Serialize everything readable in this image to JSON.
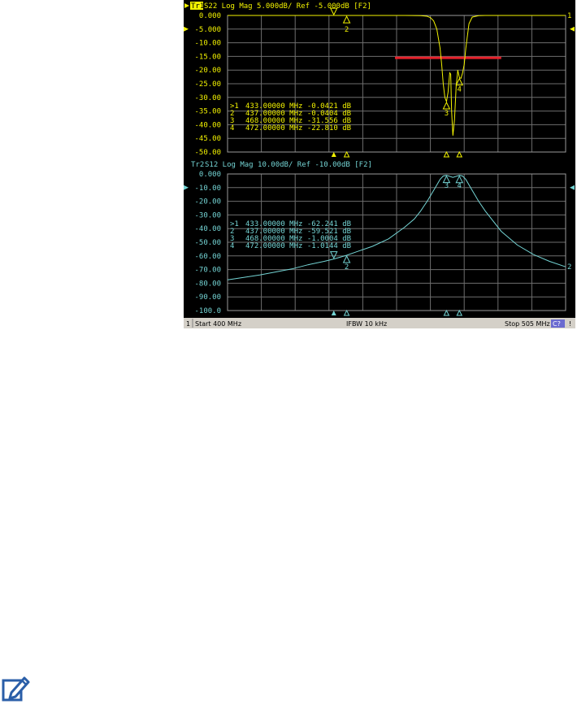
{
  "colors": {
    "background": "#000000",
    "grid": "#6e6e6e",
    "trace1": "#f2f200",
    "trace2": "#74d4d4",
    "limit_line": "#e8202a",
    "status_bar": "#d4d0c8",
    "status_text": "#000000",
    "badge_bg": "#6a6ad0"
  },
  "icons": {
    "note": "note-pencil-icon",
    "marker_down": "triangle-down",
    "marker_up": "triangle-up",
    "ref_pointer": "triangle-side"
  },
  "chart_data": [
    {
      "type": "line",
      "header": "Tr1 S22 Log Mag 5.000dB/ Ref -5.000dB [F2]",
      "trace_tag": "Tr1",
      "header_rest": " S22 Log Mag 5.000dB/ Ref -5.000dB [F2]",
      "ylim": [
        -50,
        0
      ],
      "xlim": [
        400,
        505
      ],
      "xunit": "MHz",
      "yunit": "dB",
      "grid": true,
      "ytick_labels": [
        "0.000",
        "-5.000",
        "-10.00",
        "-15.00",
        "-20.00",
        "-25.00",
        "-30.00",
        "-35.00",
        "-40.00",
        "-45.00",
        "-50.00"
      ],
      "ref_level": -5,
      "end_label": "1",
      "series": [
        {
          "x": [
            400,
            455,
            460,
            462,
            463,
            464,
            465,
            466,
            466.5,
            467,
            467.5,
            468,
            468.5,
            469,
            469.3,
            469.6,
            470,
            470.5,
            471,
            471.5,
            472,
            472.5,
            473,
            473.5,
            474,
            475,
            476,
            478,
            480,
            505
          ],
          "y": [
            0,
            0,
            -0.1,
            -0.3,
            -0.8,
            -2,
            -5,
            -12,
            -18,
            -25,
            -30,
            -31.556,
            -28,
            -21,
            -21.5,
            -35,
            -44,
            -38,
            -26,
            -20,
            -22.81,
            -23,
            -21,
            -18,
            -12,
            -3,
            -0.6,
            -0.1,
            0,
            0
          ]
        }
      ],
      "limit_line": {
        "x": [
          452,
          485
        ],
        "y": -15.5
      },
      "markers": [
        {
          "id": "1",
          "x": 433,
          "y": -0.0421,
          "label": "433.00000 MHz -0.0421 dB",
          "prefix": ">1",
          "active": true
        },
        {
          "id": "2",
          "x": 437,
          "y": -0.0404,
          "label": "437.00000 MHz -0.0404 dB",
          "prefix": " 2",
          "active": false
        },
        {
          "id": "3",
          "x": 468,
          "y": -31.556,
          "label": "468.00000 MHz -31.556 dB",
          "prefix": " 3",
          "active": false
        },
        {
          "id": "4",
          "x": 472,
          "y": -22.81,
          "label": "472.00000 MHz -22.810 dB",
          "prefix": " 4",
          "active": false
        }
      ]
    },
    {
      "type": "line",
      "header": "Tr2 S12 Log Mag 10.00dB/ Ref -10.00dB [F2]",
      "trace_tag": "Tr2",
      "header_rest": " S12 Log Mag 10.00dB/ Ref -10.00dB [F2]",
      "ylim": [
        -100,
        0
      ],
      "xlim": [
        400,
        505
      ],
      "xunit": "MHz",
      "yunit": "dB",
      "grid": true,
      "ytick_labels": [
        "0.000",
        "-10.00",
        "-20.00",
        "-30.00",
        "-40.00",
        "-50.00",
        "-60.00",
        "-70.00",
        "-80.00",
        "-90.00",
        "-100.0"
      ],
      "ref_level": -10,
      "end_label": "2",
      "series": [
        {
          "x": [
            400,
            410,
            420,
            425,
            430,
            433,
            437,
            440,
            445,
            450,
            455,
            458,
            460,
            462,
            464,
            466,
            467,
            468,
            470,
            472,
            473,
            474,
            476,
            478,
            480,
            485,
            490,
            495,
            500,
            505
          ],
          "y": [
            -77.5,
            -74,
            -69.5,
            -66.5,
            -64,
            -62.241,
            -59.521,
            -57,
            -53,
            -47.5,
            -39,
            -33,
            -27,
            -20,
            -12,
            -4,
            -1.5,
            -1.0004,
            -2.5,
            -1.0144,
            -1.5,
            -4,
            -12,
            -20,
            -27,
            -42,
            -52,
            -59,
            -64,
            -68
          ]
        }
      ],
      "markers": [
        {
          "id": "1",
          "x": 433,
          "y": -62.241,
          "label": "433.00000 MHz -62.241 dB",
          "prefix": ">1",
          "active": true
        },
        {
          "id": "2",
          "x": 437,
          "y": -59.521,
          "label": "437.00000 MHz -59.521 dB",
          "prefix": " 2",
          "active": false
        },
        {
          "id": "3",
          "x": 468,
          "y": -1.0004,
          "label": "468.00000 MHz -1.0004 dB",
          "prefix": " 3",
          "active": false
        },
        {
          "id": "4",
          "x": 472,
          "y": -1.0144,
          "label": "472.00000 MHz -1.0144 dB",
          "prefix": " 4",
          "active": false
        }
      ]
    }
  ],
  "status_bar": {
    "channel": "1",
    "start": "Start 400 MHz",
    "ifbw": "IFBW 10 kHz",
    "stop": "Stop 505 MHz",
    "badge": "C?",
    "alert": "!"
  }
}
